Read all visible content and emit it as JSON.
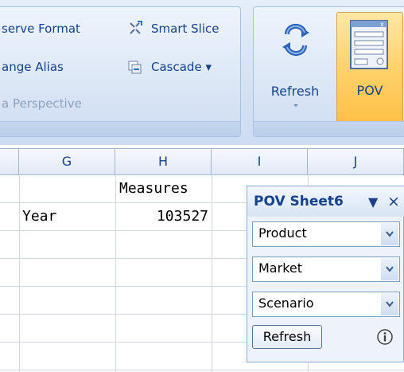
{
  "ribbon": {
    "left_group": {
      "preserve_format": "serve Format",
      "change_alias": "ange Alias",
      "data_perspective": "a Perspective",
      "smart_slice": "Smart Slice",
      "cascade": "Cascade ▾"
    },
    "right_group": {
      "refresh_label": "Refresh",
      "pov_label": "POV"
    }
  },
  "sheet": {
    "columns": [
      "G",
      "H",
      "I",
      "J"
    ],
    "cells": {
      "H1": "Measures",
      "G2": "Year",
      "H2": "103527"
    }
  },
  "pov_panel": {
    "title": "POV Sheet6",
    "menu_glyph": "▼",
    "close_glyph": "×",
    "dimensions": [
      "Product",
      "Market",
      "Scenario"
    ],
    "refresh_button": "Refresh"
  },
  "colors": {
    "ribbon_text": "#15428b",
    "pov_active_bg": "#ffd36e",
    "grid_line": "#d0d7e5"
  },
  "icons": {
    "smart_slice": "smart-slice-icon",
    "cascade": "cascade-icon",
    "refresh": "refresh-icon",
    "pov": "pov-icon",
    "dropdown": "chevron-down-icon",
    "info": "info-icon"
  }
}
